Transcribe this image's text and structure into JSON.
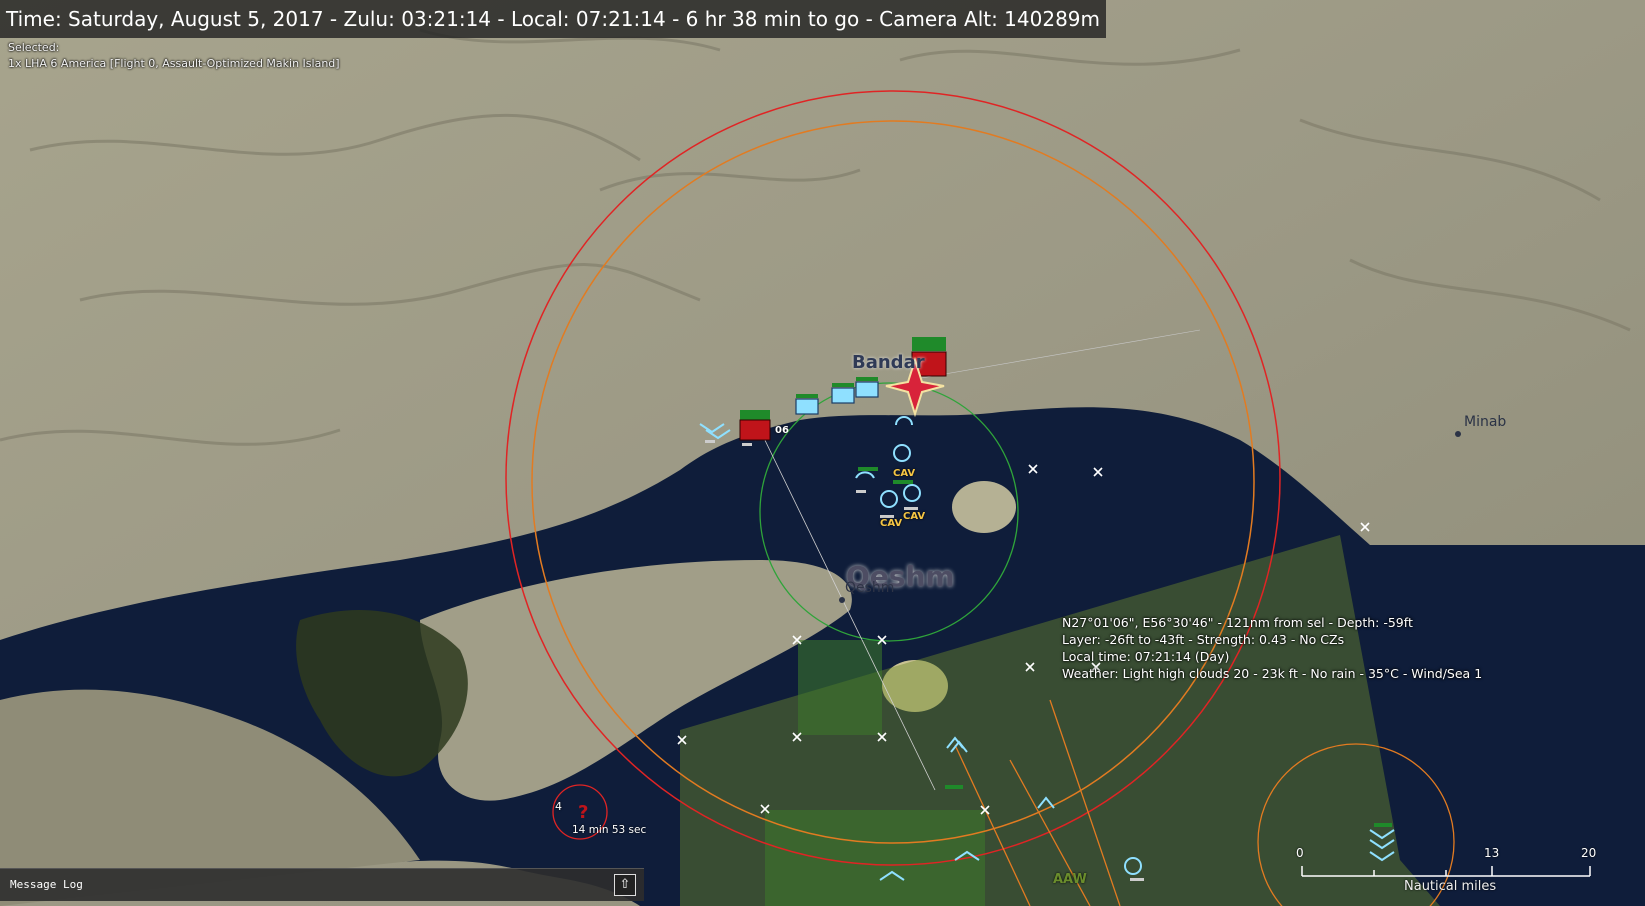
{
  "hud": {
    "time_bar": "Time: Saturday, August 5, 2017 - Zulu: 03:21:14 - Local: 07:21:14 - 6 hr 38 min to go -  Camera Alt: 140289m",
    "selected_label": "Selected:",
    "selected_unit": "1x LHA 6 America [Flight 0, Assault-Optimized Makin Island]"
  },
  "map_labels": {
    "bandar": "Bandar",
    "minab": "Minab",
    "qeshm_large": "Qeshm",
    "qeshm_small": "Qeshm"
  },
  "cursor_info": {
    "line1": "N27°01'06\", E56°30'46\" - 121nm from sel - Depth: -59ft",
    "line2": "Layer: -26ft to -43ft - Strength: 0.43 - No CZs",
    "line3": "Local time: 07:21:14 (Day)",
    "line4": "Weather: Light high clouds 20 - 23k ft - No rain - 35°C - Wind/Sea 1"
  },
  "units": {
    "cav1": "CAV",
    "cav2": "CAV",
    "cav3": "CAV",
    "label_06": "06",
    "unknown_count": "4",
    "unknown_timer": "14 min 53 sec",
    "label_aaw": "AAW"
  },
  "message_log": {
    "title": "Message Log",
    "toggle_icon": "arrow-up-icon"
  },
  "scale_bar": {
    "ticks": [
      "0",
      "13",
      "20"
    ],
    "unit": "Nautical miles"
  },
  "colors": {
    "water": "#0f1d3a",
    "land": "#9b9882",
    "range_red": "#e02424",
    "range_orange": "#e27b21",
    "range_green": "#2fa43a",
    "friendly_cyan": "#8fe0ff",
    "hostile_red": "#c0141a",
    "zone_green": "#6c8a2c"
  }
}
